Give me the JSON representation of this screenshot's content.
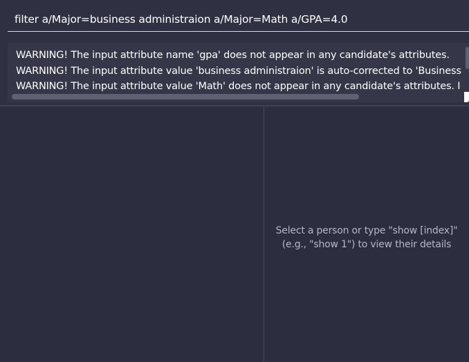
{
  "command": {
    "value": "filter a/Major=business administraion a/Major=Math a/GPA=4.0"
  },
  "result": {
    "lines": [
      "WARNING! The input attribute name 'gpa' does not appear in any candidate's attributes.",
      "WARNING! The input attribute value 'business administraion' is auto-corrected to 'Business",
      "WARNING! The input attribute value 'Math' does not appear in any candidate's attributes. I"
    ]
  },
  "detail": {
    "placeholder_line1": "Select a person or type \"show [index]\"",
    "placeholder_line2": "(e.g., \"show 1\") to view their details"
  },
  "colors": {
    "background": "#2b2d3f",
    "panel": "#2f3143",
    "result_box": "#353749",
    "text": "#ffffff",
    "muted_text": "#b4b6c4"
  }
}
